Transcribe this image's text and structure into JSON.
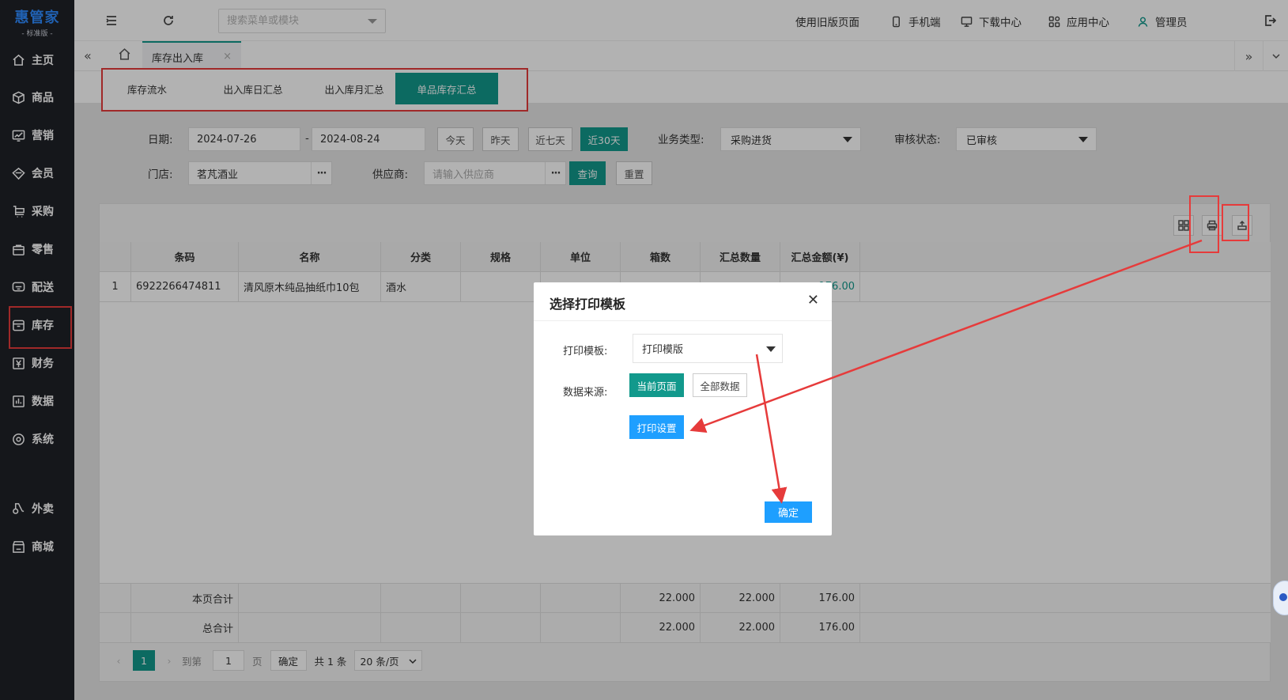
{
  "sidebar": {
    "brand": "惠管家",
    "edition": "- 标准版 -",
    "items": [
      {
        "label": "主页",
        "icon": "home-icon"
      },
      {
        "label": "商品",
        "icon": "box-icon"
      },
      {
        "label": "营销",
        "icon": "chart-icon"
      },
      {
        "label": "会员",
        "icon": "diamond-icon"
      },
      {
        "label": "采购",
        "icon": "cart-icon"
      },
      {
        "label": "零售",
        "icon": "bag-icon"
      },
      {
        "label": "配送",
        "icon": "truck-icon"
      },
      {
        "label": "库存",
        "icon": "inventory-icon"
      },
      {
        "label": "财务",
        "icon": "finance-icon"
      },
      {
        "label": "数据",
        "icon": "data-icon"
      },
      {
        "label": "系统",
        "icon": "settings-icon"
      },
      {
        "label": "外卖",
        "icon": "takeout-icon"
      },
      {
        "label": "商城",
        "icon": "store-icon"
      }
    ]
  },
  "topbar": {
    "search_placeholder": "搜索菜单或模块",
    "links": {
      "old_version": "使用旧版页面",
      "mobile": "手机端",
      "download": "下载中心",
      "apps": "应用中心",
      "admin": "管理员"
    }
  },
  "tabs": {
    "active": "库存出入库",
    "close": "×"
  },
  "subtabs": [
    "库存流水",
    "出入库日汇总",
    "出入库月汇总",
    "单品库存汇总"
  ],
  "filters": {
    "date_label": "日期:",
    "date_start": "2024-07-26",
    "date_sep": "-",
    "date_end": "2024-08-24",
    "quick": [
      "今天",
      "昨天",
      "近七天",
      "近30天"
    ],
    "biz_type_label": "业务类型:",
    "biz_type_value": "采购进货",
    "audit_label": "审核状态:",
    "audit_value": "已审核",
    "store_label": "门店:",
    "store_value": "茗芃酒业",
    "supplier_label": "供应商:",
    "supplier_placeholder": "请输入供应商",
    "query": "查询",
    "reset": "重置",
    "dots": "···"
  },
  "table": {
    "headers": [
      "",
      "条码",
      "名称",
      "分类",
      "规格",
      "单位",
      "箱数",
      "汇总数量",
      "汇总金额(¥)"
    ],
    "rows": [
      {
        "idx": "1",
        "barcode": "6922266474811",
        "name": "清风原木纯品抽纸巾10包",
        "category": "酒水",
        "spec": "",
        "unit": "",
        "boxes": "",
        "qty": "",
        "amount": "176.00"
      }
    ],
    "page_total_label": "本页合计",
    "total_label": "总合计",
    "page_total": {
      "boxes": "22.000",
      "qty": "22.000",
      "amount": "176.00"
    },
    "grand_total": {
      "boxes": "22.000",
      "qty": "22.000",
      "amount": "176.00"
    }
  },
  "pager": {
    "current": "1",
    "goto_label": "到第",
    "goto_value": "1",
    "page_unit": "页",
    "confirm": "确定",
    "total": "共 1 条",
    "per_page": "20 条/页"
  },
  "modal": {
    "title": "选择打印模板",
    "close": "✕",
    "template_label": "打印模板:",
    "template_value": "打印模版",
    "source_label": "数据来源:",
    "current_page": "当前页面",
    "all_data": "全部数据",
    "print_settings": "打印设置",
    "ok": "确定"
  },
  "colors": {
    "accent": "#12998c",
    "sidebar_bg": "#1f2128",
    "annotation_red": "#e63b3b",
    "blue_button": "#1e9fff"
  }
}
